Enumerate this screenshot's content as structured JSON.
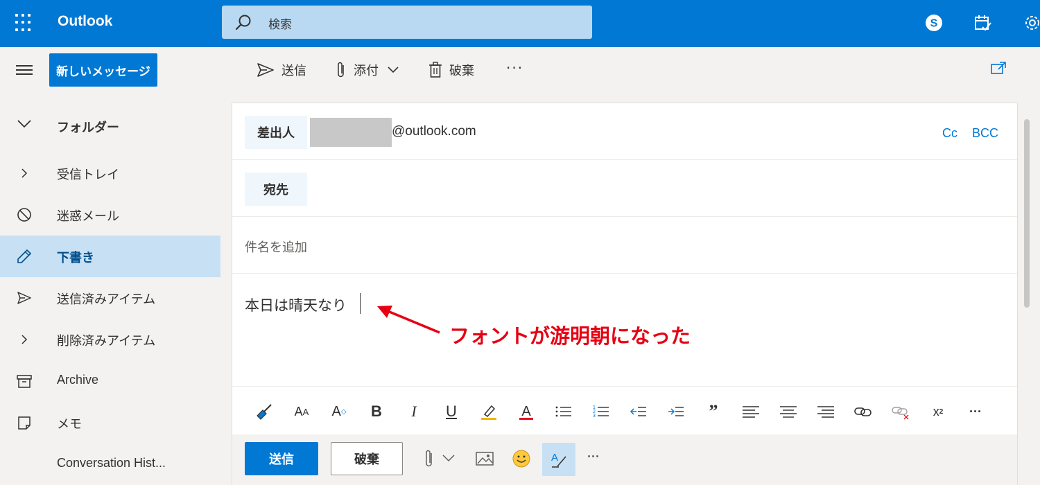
{
  "app": {
    "title": "Outlook"
  },
  "search": {
    "placeholder": "検索"
  },
  "colors": {
    "brand": "#0078d4",
    "active_nav": "#c7e0f4",
    "annotation": "#e60012"
  },
  "toolbar": {
    "new_message": "新しいメッセージ",
    "send": "送信",
    "attach": "添付",
    "discard": "破棄",
    "more": "···"
  },
  "sidebar": {
    "header": "フォルダー",
    "items": [
      {
        "label": "受信トレイ",
        "icon": "chevron-right-icon"
      },
      {
        "label": "迷惑メール",
        "icon": "block-icon"
      },
      {
        "label": "下書き",
        "icon": "pencil-icon",
        "active": true
      },
      {
        "label": "送信済みアイテム",
        "icon": "send-icon"
      },
      {
        "label": "削除済みアイテム",
        "icon": "chevron-right-icon"
      },
      {
        "label": "Archive",
        "icon": "archive-icon"
      },
      {
        "label": "メモ",
        "icon": "note-icon"
      },
      {
        "label": "Conversation Hist...",
        "icon": ""
      }
    ]
  },
  "compose": {
    "from_label": "差出人",
    "from_address": "@outlook.com",
    "cc": "Cc",
    "bcc": "BCC",
    "to_label": "宛先",
    "subject_placeholder": "件名を追加",
    "body": "本日は晴天なり"
  },
  "actions": {
    "send": "送信",
    "discard": "破棄",
    "more": "···"
  },
  "annotation": {
    "text": "フォントが游明朝になった"
  }
}
